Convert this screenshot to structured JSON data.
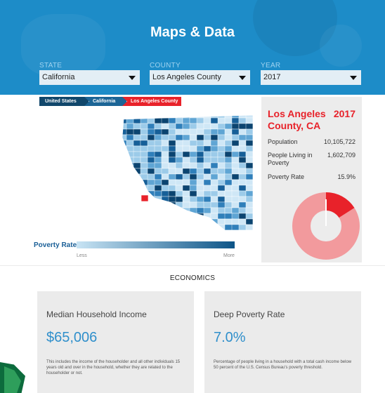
{
  "header": {
    "title": "Maps & Data"
  },
  "filters": [
    {
      "label": "STATE",
      "value": "California"
    },
    {
      "label": "COUNTY",
      "value": "Los Angeles County"
    },
    {
      "label": "YEAR",
      "value": "2017"
    }
  ],
  "breadcrumb": [
    "United States",
    "California",
    "Los Angeles County"
  ],
  "legend": {
    "title": "Poverty Rate",
    "low": "Less",
    "high": "More"
  },
  "panel": {
    "title": "Los Angeles County, CA",
    "year": "2017",
    "stats": [
      {
        "label": "Population",
        "value": "10,105,722"
      },
      {
        "label": "People Living in Poverty",
        "value": "1,602,709"
      },
      {
        "label": "Poverty Rate",
        "value": "15.9%"
      }
    ],
    "poverty_fraction": 0.159
  },
  "economics": {
    "heading": "ECONOMICS",
    "cards": [
      {
        "title": "Median Household Income",
        "value": "$65,006",
        "description": "This includes the income of the householder and all other individuals 15 years old and over in the household, whether they are related to the householder or not."
      },
      {
        "title": "Deep Poverty Rate",
        "value": "7.0%",
        "description": "Percentage of people living in a household with a total cash income below 50 percent of the U.S. Census Bureau's poverty threshold."
      }
    ]
  },
  "colors": {
    "header": "#1d8cc8",
    "accent_red": "#e8222a",
    "donut_rest": "#f29a9d",
    "value_blue": "#2f8fcb"
  },
  "icons": [
    "chevron-down-icon"
  ]
}
